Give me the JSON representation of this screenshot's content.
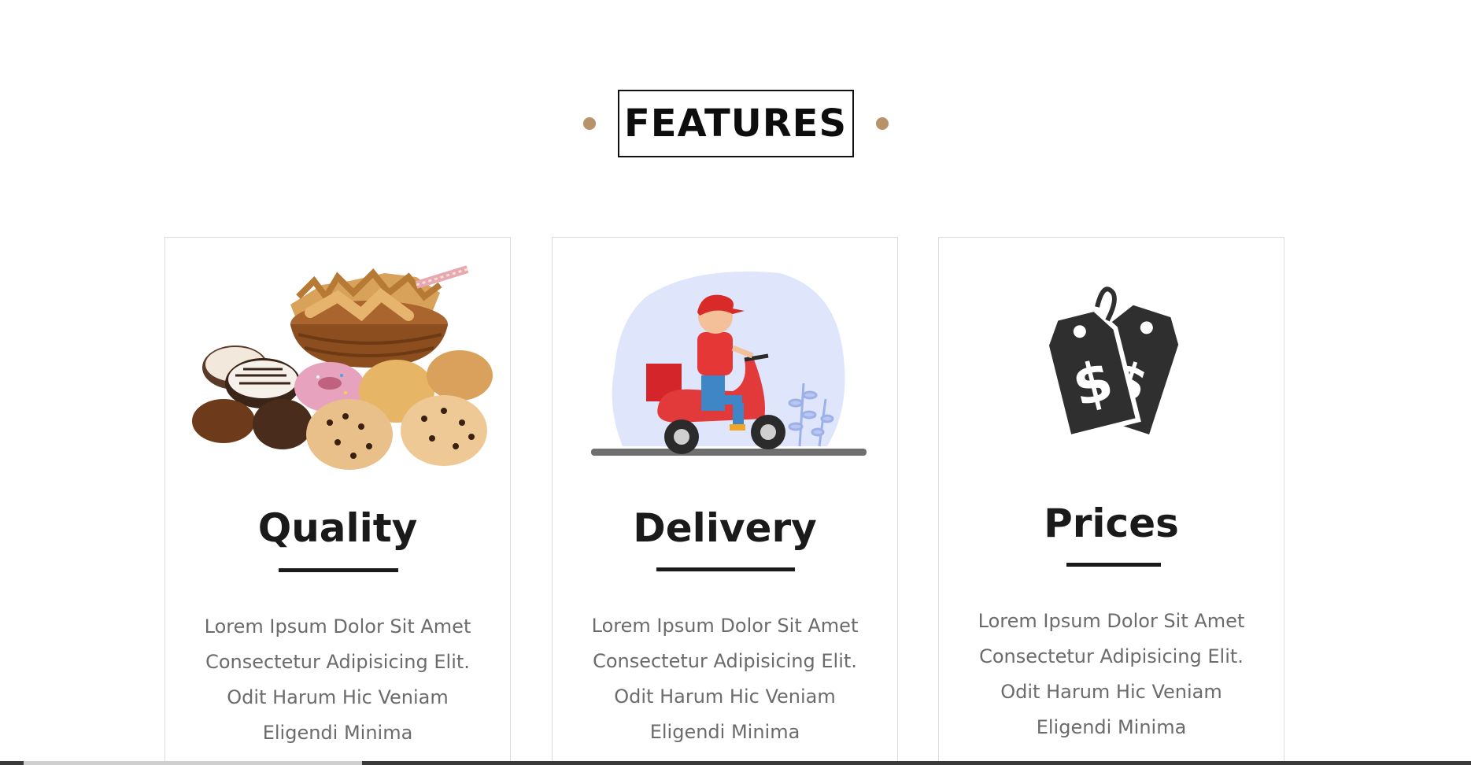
{
  "section": {
    "title": "FEATURES",
    "accent_color": "#b89268"
  },
  "features": [
    {
      "icon": "bakery-basket-image",
      "title": "Quality",
      "description_lines": [
        "Lorem Ipsum Dolor Sit Amet",
        "Consectetur Adipisicing Elit.",
        "Odit Harum Hic Veniam",
        "Eligendi Minima"
      ]
    },
    {
      "icon": "scooter-delivery-image",
      "title": "Delivery",
      "description_lines": [
        "Lorem Ipsum Dolor Sit Amet",
        "Consectetur Adipisicing Elit.",
        "Odit Harum Hic Veniam",
        "Eligendi Minima"
      ]
    },
    {
      "icon": "price-tag-icon",
      "title": "Prices",
      "description_lines": [
        "Lorem Ipsum Dolor Sit Amet",
        "Consectetur Adipisicing Elit.",
        "Odit Harum Hic Veniam",
        "Eligendi Minima"
      ]
    }
  ]
}
